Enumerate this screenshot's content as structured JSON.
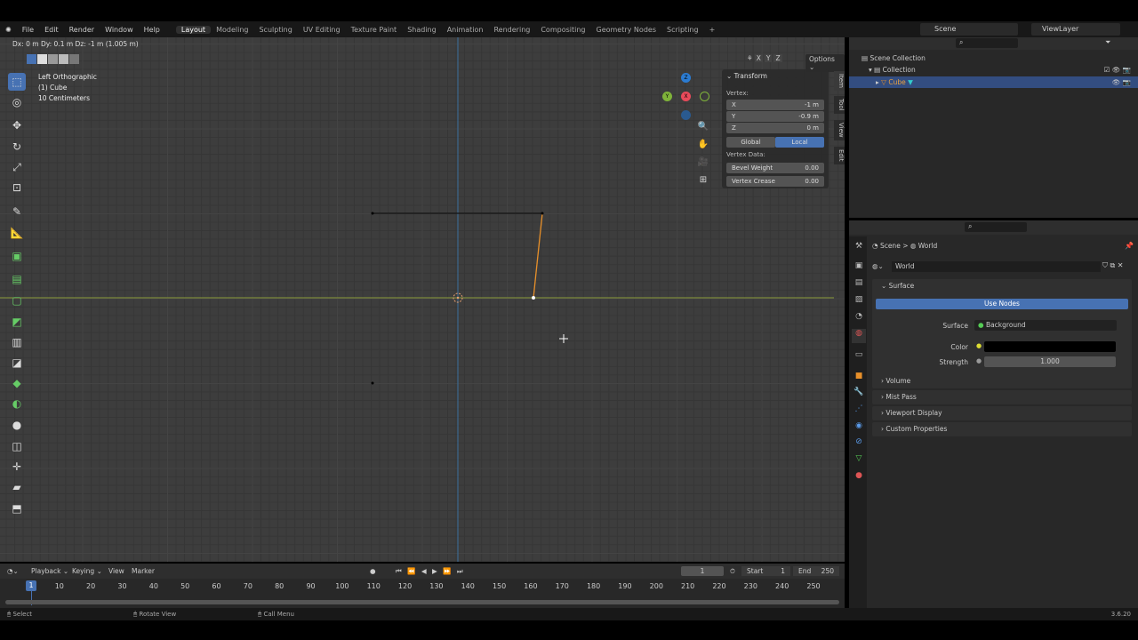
{
  "menu": {
    "items": [
      "File",
      "Edit",
      "Render",
      "Window",
      "Help"
    ],
    "workspaces": [
      "Layout",
      "Modeling",
      "Sculpting",
      "UV Editing",
      "Texture Paint",
      "Shading",
      "Animation",
      "Rendering",
      "Compositing",
      "Geometry Nodes",
      "Scripting"
    ],
    "add": "+",
    "scene": "Scene",
    "view_layer": "ViewLayer"
  },
  "viewport": {
    "header_info": "Dx: 0 m  Dy: 0.1 m  Dz: -1 m (1.005 m)",
    "view_name": "Left Orthographic",
    "object": "(1) Cube",
    "scale": "10 Centimeters",
    "axes": [
      "X",
      "Y",
      "Z"
    ],
    "options": "Options",
    "gizmo": {
      "z": "Z",
      "y": "Y",
      "x": "X"
    }
  },
  "npanel": {
    "title": "Transform",
    "vertex_label": "Vertex:",
    "fields": [
      {
        "label": "X",
        "value": "-1 m"
      },
      {
        "label": "Y",
        "value": "-0.9 m"
      },
      {
        "label": "Z",
        "value": "0 m"
      }
    ],
    "global": "Global",
    "local": "Local",
    "vertex_data": "Vertex Data:",
    "bevel": {
      "label": "Bevel Weight",
      "value": "0.00"
    },
    "crease": {
      "label": "Vertex Crease",
      "value": "0.00"
    },
    "tabs": [
      "Item",
      "Tool",
      "View",
      "Edit"
    ]
  },
  "outliner": {
    "scene_collection": "Scene Collection",
    "collection": "Collection",
    "cube": "Cube"
  },
  "properties": {
    "breadcrumb": [
      "Scene",
      "World"
    ],
    "world_name": "World",
    "surface_section": "Surface",
    "use_nodes": "Use Nodes",
    "surface_label": "Surface",
    "surface_value": "Background",
    "color_label": "Color",
    "strength_label": "Strength",
    "strength_value": "1.000",
    "sections": [
      "Volume",
      "Mist Pass",
      "Viewport Display",
      "Custom Properties"
    ]
  },
  "timeline": {
    "menus": [
      "Playback",
      "Keying",
      "View",
      "Marker"
    ],
    "current_frame": "1",
    "start_label": "Start",
    "start": "1",
    "end_label": "End",
    "end": "250",
    "ticks": [
      "10",
      "20",
      "30",
      "40",
      "50",
      "60",
      "70",
      "80",
      "90",
      "100",
      "110",
      "120",
      "130",
      "140",
      "150",
      "160",
      "170",
      "180",
      "190",
      "200",
      "210",
      "220",
      "230",
      "240",
      "250"
    ],
    "playhead": "1"
  },
  "status": {
    "select": "Select",
    "rotate": "Rotate View",
    "menu": "Call Menu",
    "version": "3.6.20"
  }
}
